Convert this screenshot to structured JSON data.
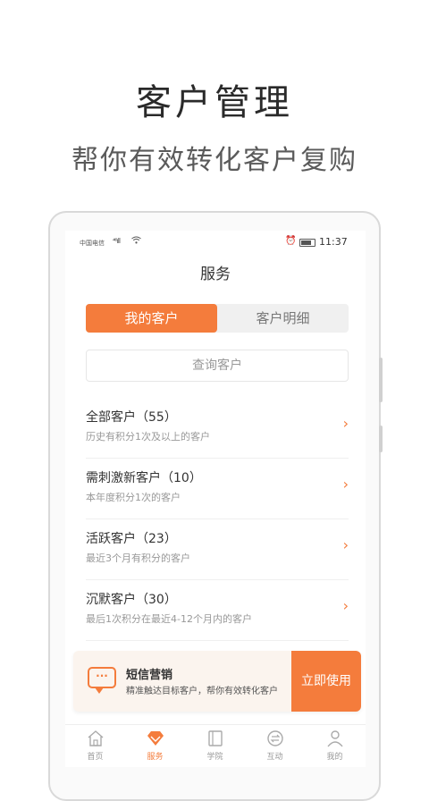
{
  "hero": {
    "title": "客户管理",
    "subtitle": "帮你有效转化客户复购"
  },
  "status_bar": {
    "carrier": "中国电信",
    "signal": "⁴⁶ıll",
    "time": "11:37"
  },
  "nav": {
    "title": "服务"
  },
  "tabs": [
    {
      "label": "我的客户",
      "active": true
    },
    {
      "label": "客户明细",
      "active": false
    }
  ],
  "search": {
    "placeholder": "查询客户"
  },
  "customer_groups": [
    {
      "title": "全部客户（55）",
      "desc": "历史有积分1次及以上的客户"
    },
    {
      "title": "需刺激新客户（10）",
      "desc": "本年度积分1次的客户"
    },
    {
      "title": "活跃客户（23）",
      "desc": "最近3个月有积分的客户"
    },
    {
      "title": "沉默客户（30）",
      "desc": "最后1次积分在最近4-12个月内的客户"
    }
  ],
  "banner": {
    "title": "短信营销",
    "desc": "精准触达目标客户，帮你有效转化客户",
    "button": "立即使用",
    "icon": "sms-bubble-icon"
  },
  "tabbar": [
    {
      "label": "首页",
      "icon": "home-icon",
      "active": false
    },
    {
      "label": "服务",
      "icon": "diamond-icon",
      "active": true
    },
    {
      "label": "学院",
      "icon": "book-icon",
      "active": false
    },
    {
      "label": "互动",
      "icon": "interact-icon",
      "active": false
    },
    {
      "label": "我的",
      "icon": "user-icon",
      "active": false
    }
  ],
  "colors": {
    "accent": "#f47c3c",
    "banner_bg": "#fbf4ee"
  }
}
